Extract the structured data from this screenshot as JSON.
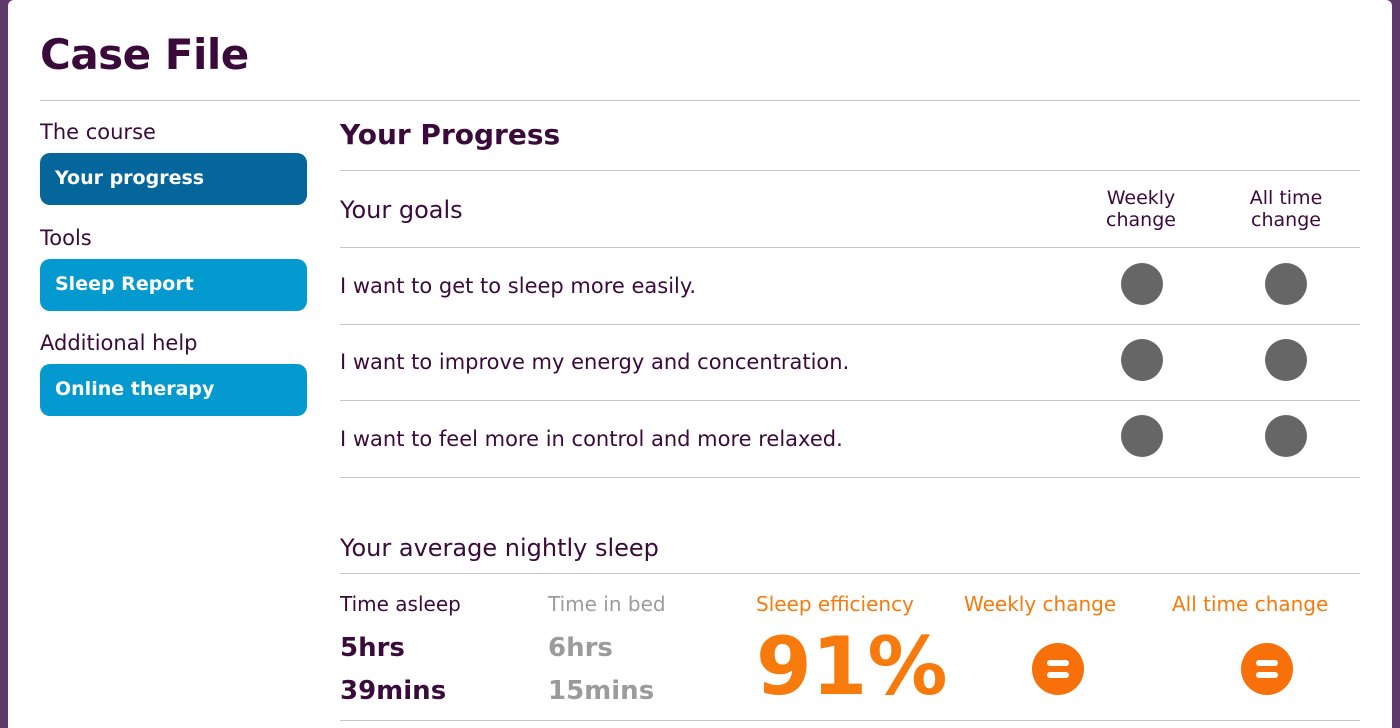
{
  "page": {
    "title": "Case File"
  },
  "sidebar": {
    "sections": [
      {
        "heading": "The course",
        "button": "Your progress"
      },
      {
        "heading": "Tools",
        "button": "Sleep Report"
      },
      {
        "heading": "Additional help",
        "button": "Online therapy"
      }
    ]
  },
  "main": {
    "title": "Your Progress",
    "goals": {
      "title": "Your goals",
      "col_weekly": [
        "Weekly",
        "change"
      ],
      "col_alltime": [
        "All time",
        "change"
      ],
      "items": [
        "I want to get to sleep more easily.",
        "I want to improve my energy and concentration.",
        "I want to feel more in control and more relaxed."
      ]
    },
    "sleep": {
      "title": "Your average nightly sleep",
      "time_asleep": {
        "label": "Time asleep",
        "line1": "5hrs",
        "line2": "39mins"
      },
      "time_in_bed": {
        "label": "Time in bed",
        "line1": "6hrs",
        "line2": "15mins"
      },
      "efficiency": {
        "label": "Sleep efficiency",
        "value": "91%"
      },
      "weekly_change": {
        "label": "Weekly change",
        "icon": "equals-icon"
      },
      "alltime_change": {
        "label": "All time change",
        "icon": "equals-icon"
      }
    }
  },
  "colors": {
    "brand_dark": "#3a0a3a",
    "button_active": "#04669a",
    "button_tool": "#0499cf",
    "accent_orange": "#f77a0d",
    "status_dot": "#666666"
  }
}
